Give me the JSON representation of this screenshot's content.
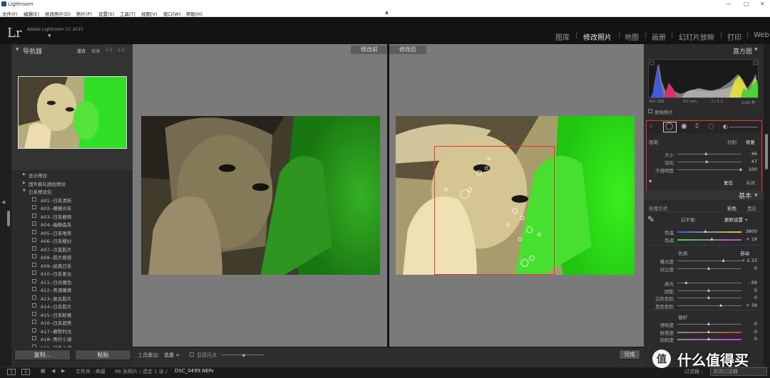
{
  "window": {
    "title": "Lightroom"
  },
  "menu": [
    "文件(F)",
    "编辑(E)",
    "修改照片(D)",
    "照片(P)",
    "设置(S)",
    "工具(T)",
    "视图(V)",
    "窗口(W)",
    "帮助(H)"
  ],
  "identity": {
    "logo": "Lr",
    "app_name": "Adobe Lightroom CC 2015"
  },
  "modules": [
    "图库",
    "修改照片",
    "地图",
    "画册",
    "幻灯片放映",
    "打印",
    "Web"
  ],
  "active_module": "修改照片",
  "navigator": {
    "title": "导航器",
    "options": [
      "适合",
      "填满",
      "1:1",
      "1:2"
    ]
  },
  "presets": [
    {
      "type": "folder",
      "label": "显示预设",
      "open": false
    },
    {
      "type": "folder",
      "label": "国外植礼跟拍预设",
      "open": false
    },
    {
      "type": "folder",
      "label": "日系预设包",
      "open": true
    },
    {
      "type": "item",
      "label": "A01--日系清新"
    },
    {
      "type": "item",
      "label": "A02--暖暖光年"
    },
    {
      "type": "item",
      "label": "A03--日系静物"
    },
    {
      "type": "item",
      "label": "A04--幽静森系"
    },
    {
      "type": "item",
      "label": "A05--日系唯美"
    },
    {
      "type": "item",
      "label": "A06--日系樱纱"
    },
    {
      "type": "item",
      "label": "A07--冷蓝胶片"
    },
    {
      "type": "item",
      "label": "A08--胶片质感"
    },
    {
      "type": "item",
      "label": "A09--经典日系"
    },
    {
      "type": "item",
      "label": "A10--日系复古"
    },
    {
      "type": "item",
      "label": "A11--日光暖色"
    },
    {
      "type": "item",
      "label": "A12--青调暖黄"
    },
    {
      "type": "item",
      "label": "A13--复古胶片"
    },
    {
      "type": "item",
      "label": "A14--日系胶片"
    },
    {
      "type": "item",
      "label": "A15--日系粉黄"
    },
    {
      "type": "item",
      "label": "A16--日系超美"
    },
    {
      "type": "item",
      "label": "A17--静默时光"
    },
    {
      "type": "item",
      "label": "A18--青柠小调"
    },
    {
      "type": "item",
      "label": "A19--日系小调"
    }
  ],
  "left_buttons": {
    "copy": "复制...",
    "paste": "粘贴"
  },
  "view_labels": {
    "before": "修改前",
    "after": "修改后"
  },
  "toolbar": {
    "label": "工具叠加:",
    "value": "总是 ÷",
    "dust_label": "显现污点",
    "done": "完成"
  },
  "histogram": {
    "title": "直方图",
    "meta": [
      "ISO 200",
      "50 mm",
      "f / 3.2",
      "1/25 秒"
    ],
    "original_label": "原始照片"
  },
  "spot_tool": {
    "brush_label": "画笔:",
    "modes": [
      "仿制",
      "修复"
    ],
    "active_mode": "修复",
    "sliders": [
      {
        "label": "大小",
        "value": "46",
        "pos": 0.46
      },
      {
        "label": "羽化",
        "value": "47",
        "pos": 0.47
      },
      {
        "label": "不透明度",
        "value": "100",
        "pos": 1.0
      }
    ],
    "reset": "复位",
    "close": "关闭"
  },
  "basic": {
    "title": "基本",
    "treatment_label": "处理方式:",
    "treatments": [
      "彩色",
      "黑白"
    ],
    "wb_label": "白平衡:",
    "wb_value": "原照设置 ÷",
    "wb_sliders": [
      {
        "label": "色温",
        "value": "3800",
        "pos": 0.45
      },
      {
        "label": "色调",
        "value": "+ 18",
        "pos": 0.55
      }
    ],
    "tone_label": "色调",
    "auto": "自动",
    "tone_sliders": [
      {
        "label": "曝光度",
        "value": "+ 2.33",
        "pos": 0.73
      },
      {
        "label": "对比度",
        "value": "0",
        "pos": 0.5
      },
      {
        "label": "高光",
        "value": "- 69",
        "pos": 0.15
      },
      {
        "label": "阴影",
        "value": "0",
        "pos": 0.5
      },
      {
        "label": "白色色阶",
        "value": "0",
        "pos": 0.5
      },
      {
        "label": "黑色色阶",
        "value": "+ 38",
        "pos": 0.69
      }
    ],
    "presence_label": "偏好",
    "presence_sliders": [
      {
        "label": "清晰度",
        "value": "0",
        "pos": 0.5
      },
      {
        "label": "鲜艳度",
        "value": "0",
        "pos": 0.5
      },
      {
        "label": "饱和度",
        "value": "0",
        "pos": 0.5
      }
    ]
  },
  "filmstrip": {
    "pages": [
      "1",
      "2"
    ],
    "source": "文件夹 : 典摄",
    "count": "88 张照片 / 选定 1 张 /",
    "filename": "DSC_0499.NEF",
    "filter_label": "过滤器 :",
    "filter_value": "关闭过滤器"
  },
  "watermark": "什么值得买"
}
